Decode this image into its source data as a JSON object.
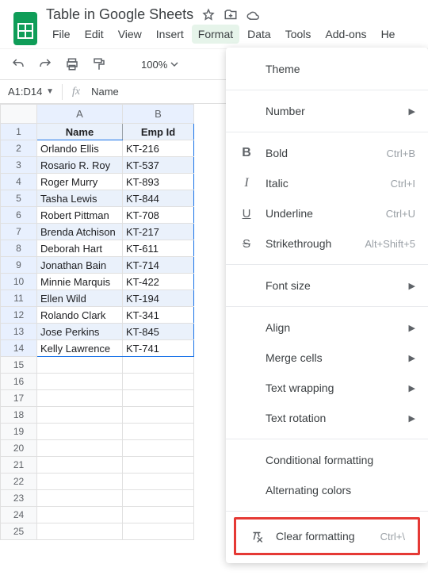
{
  "doc_title": "Table in Google Sheets",
  "menus": {
    "file": "File",
    "edit": "Edit",
    "view": "View",
    "insert": "Insert",
    "format": "Format",
    "data": "Data",
    "tools": "Tools",
    "addons": "Add-ons",
    "help": "He"
  },
  "toolbar": {
    "zoom": "100%"
  },
  "namebox": {
    "ref": "A1:D14",
    "fx_value": "Name"
  },
  "columns": [
    "A",
    "B"
  ],
  "header_row": {
    "c0": "Name",
    "c1": "Emp Id"
  },
  "rows": [
    {
      "n": "Orlando Ellis",
      "e": "KT-216"
    },
    {
      "n": "Rosario R. Roy",
      "e": "KT-537"
    },
    {
      "n": "Roger Murry",
      "e": "KT-893"
    },
    {
      "n": "Tasha Lewis",
      "e": "KT-844"
    },
    {
      "n": "Robert Pittman",
      "e": "KT-708"
    },
    {
      "n": "Brenda Atchison",
      "e": "KT-217"
    },
    {
      "n": "Deborah Hart",
      "e": "KT-611"
    },
    {
      "n": "Jonathan Bain",
      "e": "KT-714"
    },
    {
      "n": "Minnie Marquis",
      "e": "KT-422"
    },
    {
      "n": "Ellen Wild",
      "e": "KT-194"
    },
    {
      "n": "Rolando Clark",
      "e": "KT-341"
    },
    {
      "n": "Jose Perkins",
      "e": "KT-845"
    },
    {
      "n": "Kelly Lawrence",
      "e": "KT-741"
    }
  ],
  "empty_rows": [
    15,
    16,
    17,
    18,
    19,
    20,
    21,
    22,
    23,
    24,
    25
  ],
  "format_menu": {
    "theme": "Theme",
    "number": "Number",
    "bold": "Bold",
    "bold_k": "Ctrl+B",
    "italic": "Italic",
    "italic_k": "Ctrl+I",
    "underline": "Underline",
    "underline_k": "Ctrl+U",
    "strike": "Strikethrough",
    "strike_k": "Alt+Shift+5",
    "fontsize": "Font size",
    "align": "Align",
    "merge": "Merge cells",
    "wrap": "Text wrapping",
    "rot": "Text rotation",
    "cond": "Conditional formatting",
    "alt": "Alternating colors",
    "clear": "Clear formatting",
    "clear_k": "Ctrl+\\"
  }
}
